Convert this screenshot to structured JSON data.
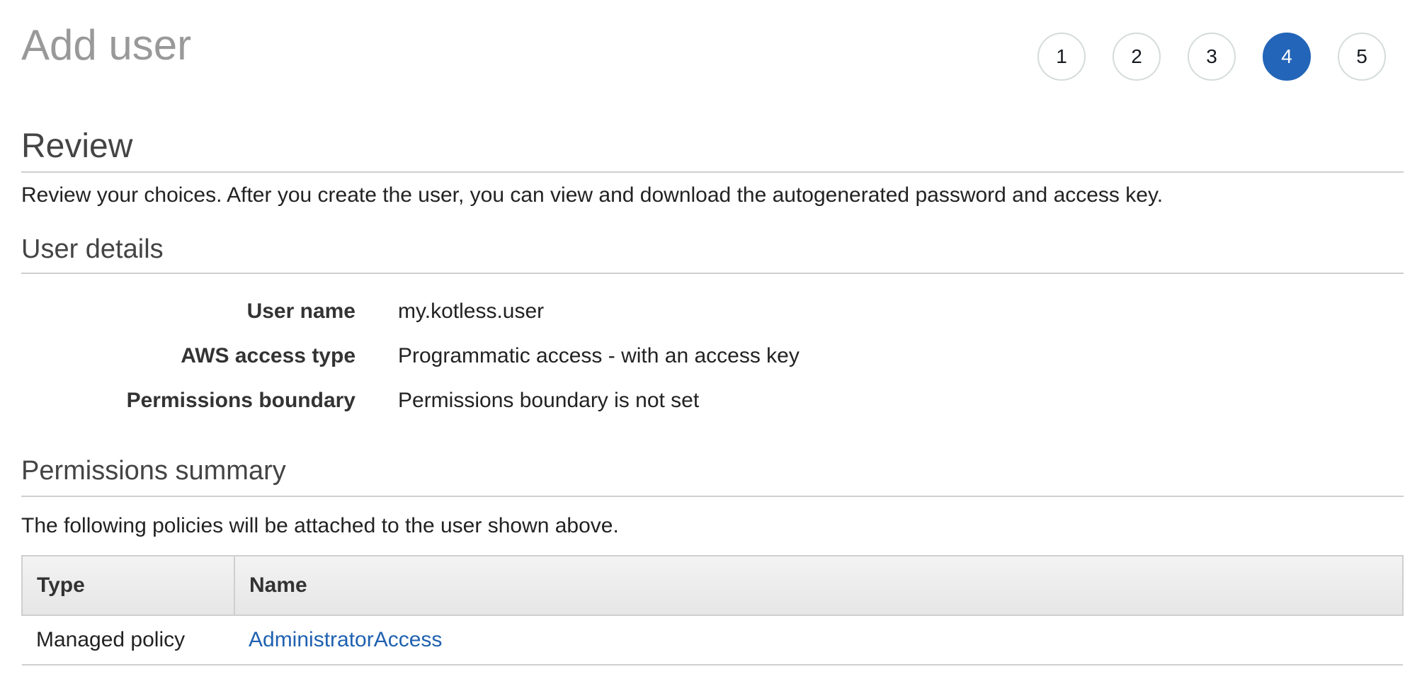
{
  "page": {
    "title": "Add user"
  },
  "steps": [
    {
      "label": "1",
      "active": false
    },
    {
      "label": "2",
      "active": false
    },
    {
      "label": "3",
      "active": false
    },
    {
      "label": "4",
      "active": true
    },
    {
      "label": "5",
      "active": false
    }
  ],
  "review": {
    "title": "Review",
    "description": "Review your choices. After you create the user, you can view and download the autogenerated password and access key."
  },
  "user_details": {
    "title": "User details",
    "rows": [
      {
        "label": "User name",
        "value": "my.kotless.user"
      },
      {
        "label": "AWS access type",
        "value": "Programmatic access - with an access key"
      },
      {
        "label": "Permissions boundary",
        "value": "Permissions boundary is not set"
      }
    ]
  },
  "permissions": {
    "title": "Permissions summary",
    "description": "The following policies will be attached to the user shown above.",
    "columns": [
      "Type",
      "Name"
    ],
    "rows": [
      {
        "type": "Managed policy",
        "name": "AdministratorAccess"
      }
    ]
  },
  "colors": {
    "accent": "#2365b8",
    "link": "#1f61b0",
    "title_gray": "#999999"
  }
}
